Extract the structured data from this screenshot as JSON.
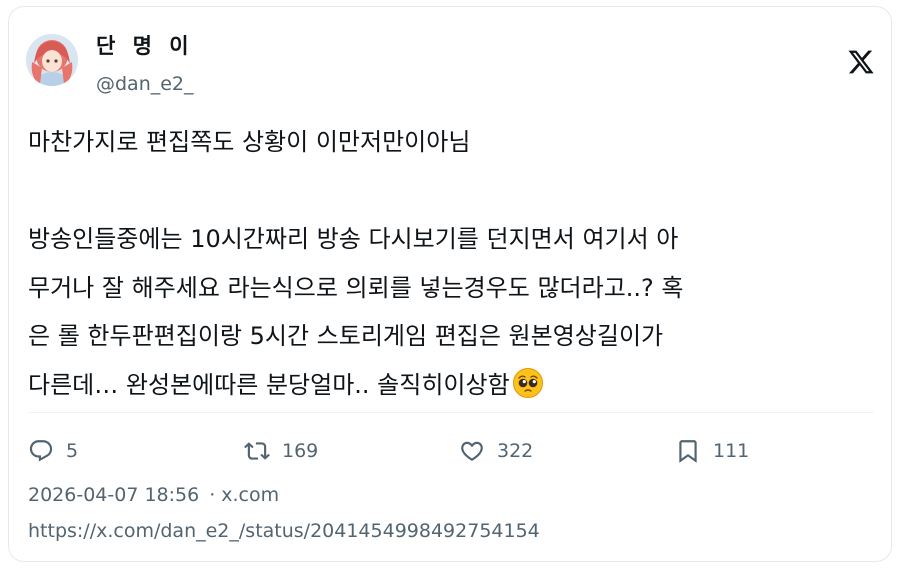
{
  "author": {
    "display_name": "단 명 이",
    "handle": "@dan_e2_"
  },
  "brand_icon": "x-logo-icon",
  "tweet": {
    "lines": [
      "마찬가지로 편집쪽도 상황이 이만저만이아님",
      "",
      "방송인들중에는 10시간짜리 방송 다시보기를 던지면서 여기서 아",
      "무거나 잘 해주세요 라는식으로 의뢰를 넣는경우도 많더라고..? 혹",
      "은 롤 한두판편집이랑 5시간 스토리게임 편집은 원본영상길이가",
      "다른데… 완성본에따른 분당얼마.. 솔직히이상함"
    ],
    "emoji": "pleading-face-emoji"
  },
  "actions": {
    "replies": "5",
    "reposts": "169",
    "likes": "322",
    "bookmarks": "111"
  },
  "meta": {
    "timestamp": "2026-04-07 18:56",
    "separator": "·",
    "source": "x.com",
    "url": "https://x.com/dan_e2_/status/2041454998492754154"
  },
  "colors": {
    "text": "#0f1419",
    "secondary": "#536471",
    "border": "#e6e9ec"
  }
}
